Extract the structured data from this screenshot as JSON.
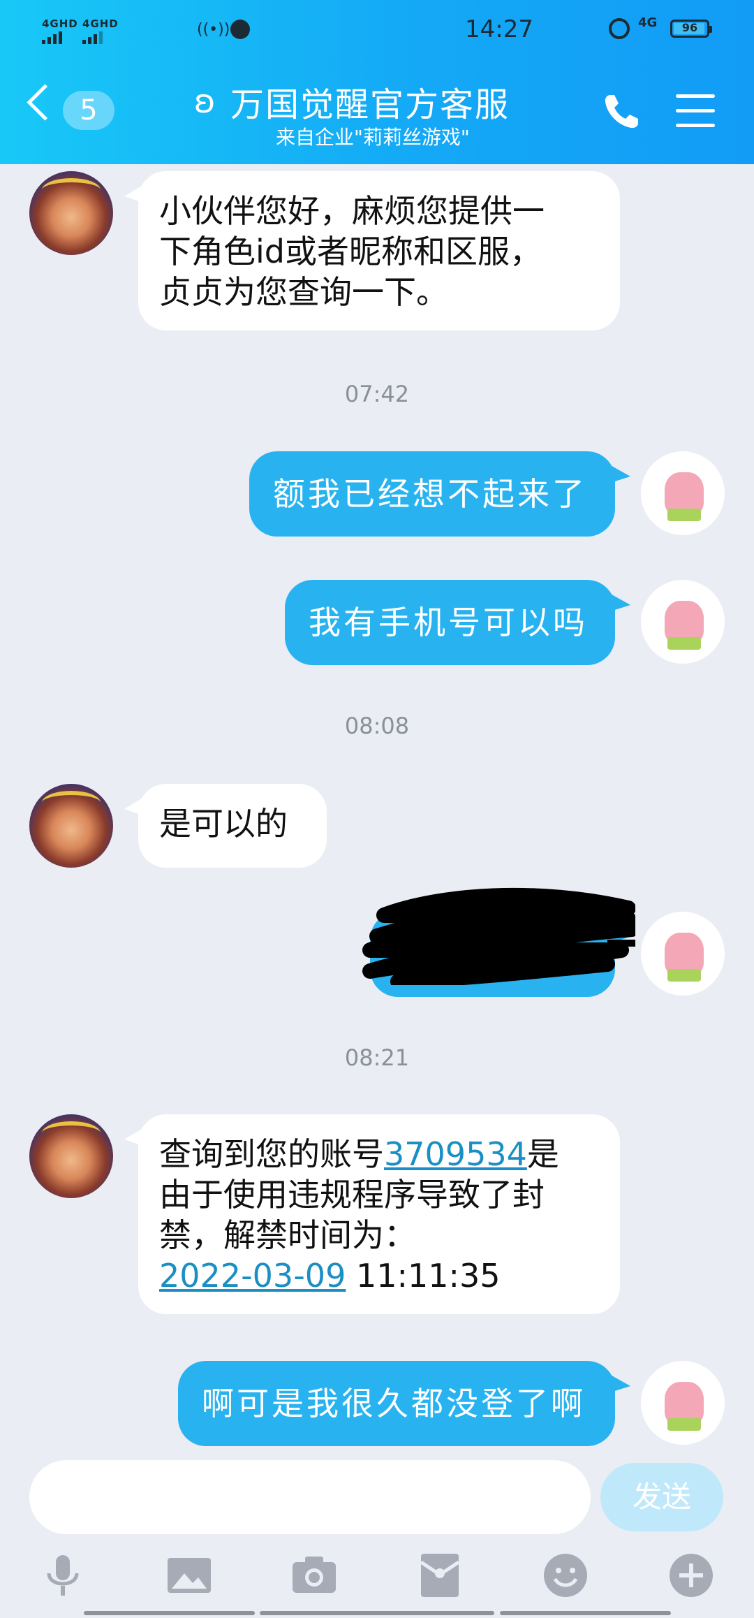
{
  "status_bar": {
    "sim1": "4GHD",
    "sim2": "4GHD",
    "time": "14:27",
    "network": "4G",
    "battery": "96"
  },
  "header": {
    "unread_count": "5",
    "title": "万国觉醒官方客服",
    "subtitle": "来自企业\"莉莉丝游戏\""
  },
  "messages": {
    "m1": {
      "line1": "小伙伴您好，麻烦您提供一",
      "line2": "下角色id或者昵称和区服，",
      "line3": "贞贞为您查询一下。"
    },
    "t1": "07:42",
    "m2": "额我已经想不起来了",
    "m3": "我有手机号可以吗",
    "t2": "08:08",
    "m4": "是可以的",
    "t3": "08:21",
    "m6": {
      "prefix": "查询到您的账号",
      "account": "3709534",
      "suffix": "是",
      "line2": "由于使用违规程序导致了封",
      "line3": "禁，解禁时间为：",
      "date": "2022-03-09",
      "time": " 11:11:35"
    },
    "m7": "啊可是我很久都没登了啊"
  },
  "composer": {
    "send_label": "发送"
  },
  "toolbar": [
    "microphone-icon",
    "image-icon",
    "camera-icon",
    "red-packet-icon",
    "emoji-icon",
    "plus-icon"
  ],
  "colors": {
    "header_start": "#18c8f7",
    "header_end": "#129cf6",
    "user_bubble": "#28b3f0",
    "link": "#1a8fc4",
    "chat_bg": "#eaedf4"
  }
}
